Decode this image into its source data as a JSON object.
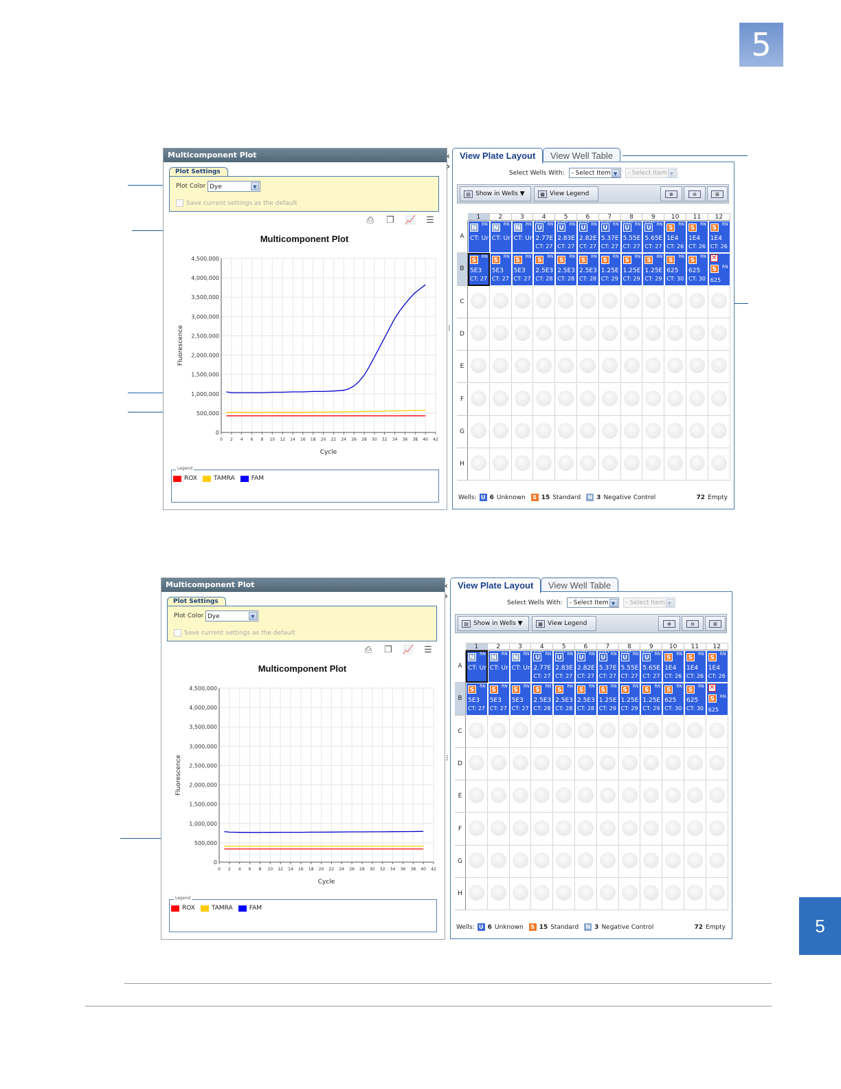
{
  "chapter_number": "5",
  "ui": {
    "panel_title": "Multicomponent Plot",
    "plot_settings_label": "Plot Settings",
    "plot_color_label": "Plot Color",
    "plot_color_value": "Dye",
    "save_default_label": "Save current settings as the default",
    "plot_title": "Multicomponent Plot",
    "y_axis_label": "Fluorescence",
    "x_axis_label": "Cycle",
    "legend_caption": "Legend",
    "legend": [
      {
        "name": "ROX",
        "color": "#ff0000"
      },
      {
        "name": "TAMRA",
        "color": "#ffcc00"
      },
      {
        "name": "FAM",
        "color": "#0000ff"
      }
    ],
    "tab_layout": "View Plate Layout",
    "tab_table": "View Well Table",
    "select_wells_label": "Select Wells With:",
    "select_item": "- Select Item -",
    "show_in_wells": "Show in Wells ▼",
    "view_legend": "View Legend",
    "columns": [
      "1",
      "2",
      "3",
      "4",
      "5",
      "6",
      "7",
      "8",
      "9",
      "10",
      "11",
      "12"
    ],
    "rows": [
      "A",
      "B",
      "C",
      "D",
      "E",
      "F",
      "G",
      "H"
    ],
    "footer": {
      "wells_label": "Wells:",
      "unknown_count": "6",
      "unknown_label": "Unknown",
      "standard_count": "15",
      "standard_label": "Standard",
      "neg_count": "3",
      "neg_label": "Negative Control",
      "empty_count": "72",
      "empty_label": "Empty"
    },
    "well_rn": "RN",
    "row_a": [
      {
        "type": "N",
        "top": "",
        "v1": "CT: Ur",
        "v2": ""
      },
      {
        "type": "N",
        "top": "",
        "v1": "CT: Ur",
        "v2": ""
      },
      {
        "type": "N",
        "top": "",
        "v1": "CT: Ur",
        "v2": ""
      },
      {
        "type": "U",
        "top": "2391",
        "v1": "2.77E",
        "v2": "CT: 27"
      },
      {
        "type": "U",
        "top": "2391",
        "v1": "2.83E",
        "v2": "CT: 27"
      },
      {
        "type": "U",
        "top": "2391",
        "v1": "2.82E",
        "v2": "CT: 27"
      },
      {
        "type": "U",
        "top": "2391",
        "v1": "5.37E",
        "v2": "CT: 27"
      },
      {
        "type": "U",
        "top": "2391",
        "v1": "5.55E",
        "v2": "CT: 27"
      },
      {
        "type": "U",
        "top": "2391",
        "v1": "5.65E",
        "v2": "CT: 27"
      },
      {
        "type": "S",
        "top": "",
        "v1": "1E4",
        "v2": "CT: 26"
      },
      {
        "type": "S",
        "top": "",
        "v1": "1E4",
        "v2": "CT: 26"
      },
      {
        "type": "S",
        "top": "",
        "v1": "1E4",
        "v2": "CT: 26"
      }
    ],
    "row_b": [
      {
        "type": "S",
        "top": "",
        "v1": "5E3",
        "v2": "CT: 27"
      },
      {
        "type": "S",
        "top": "",
        "v1": "5E3",
        "v2": "CT: 27"
      },
      {
        "type": "S",
        "top": "",
        "v1": "5E3",
        "v2": "CT: 27"
      },
      {
        "type": "S",
        "top": "",
        "v1": "2.5E3",
        "v2": "CT: 28"
      },
      {
        "type": "S",
        "top": "",
        "v1": "2.5E3",
        "v2": "CT: 28"
      },
      {
        "type": "S",
        "top": "",
        "v1": "2.5E3",
        "v2": "CT: 28"
      },
      {
        "type": "S",
        "top": "",
        "v1": "1.25E",
        "v2": "CT: 29"
      },
      {
        "type": "S",
        "top": "",
        "v1": "1.25E",
        "v2": "CT: 29"
      },
      {
        "type": "S",
        "top": "",
        "v1": "1.25E",
        "v2": "CT: 29"
      },
      {
        "type": "S",
        "top": "",
        "v1": "625",
        "v2": "CT: 30"
      },
      {
        "type": "S",
        "top": "",
        "v1": "625",
        "v2": "CT: 30"
      },
      {
        "type": "X",
        "top": "",
        "v1": "",
        "v2": "625"
      }
    ]
  },
  "chart_data": [
    {
      "type": "line",
      "title": "Multicomponent Plot",
      "xlabel": "Cycle",
      "ylabel": "Fluorescence",
      "xlim": [
        0,
        42
      ],
      "ylim": [
        0,
        4500000
      ],
      "xticks": [
        "0",
        "2",
        "4",
        "6",
        "8",
        "10",
        "12",
        "14",
        "16",
        "18",
        "20",
        "22",
        "24",
        "26",
        "28",
        "30",
        "32",
        "34",
        "36",
        "38",
        "40",
        "42"
      ],
      "yticks": [
        "0",
        "500,000",
        "1,000,000",
        "1,500,000",
        "2,000,000",
        "2,500,000",
        "3,000,000",
        "3,500,000",
        "4,000,000",
        "4,500,000"
      ],
      "grid": true,
      "x": [
        1,
        2,
        4,
        6,
        8,
        10,
        12,
        14,
        16,
        18,
        20,
        22,
        24,
        25,
        26,
        27,
        28,
        29,
        30,
        31,
        32,
        33,
        34,
        35,
        36,
        37,
        38,
        39,
        40
      ],
      "series": [
        {
          "name": "ROX",
          "color": "#ff0000",
          "values": [
            430000,
            430000,
            430000,
            430000,
            430000,
            430000,
            430000,
            430000,
            430000,
            430000,
            430000,
            430000,
            430000,
            430000,
            430000,
            430000,
            430000,
            430000,
            430000,
            430000,
            430000,
            430000,
            430000,
            430000,
            430000,
            430000,
            430000,
            430000,
            430000
          ]
        },
        {
          "name": "TAMRA",
          "color": "#ffcc00",
          "values": [
            520000,
            520000,
            520000,
            520000,
            520000,
            520000,
            520000,
            520000,
            520000,
            525000,
            525000,
            530000,
            530000,
            535000,
            535000,
            540000,
            540000,
            545000,
            545000,
            550000,
            550000,
            555000,
            555000,
            560000,
            560000,
            565000,
            565000,
            570000,
            575000
          ]
        },
        {
          "name": "FAM",
          "color": "#0000cc",
          "values": [
            1050000,
            1030000,
            1030000,
            1030000,
            1030000,
            1040000,
            1040000,
            1050000,
            1050000,
            1060000,
            1060000,
            1070000,
            1090000,
            1130000,
            1200000,
            1320000,
            1480000,
            1700000,
            1950000,
            2200000,
            2450000,
            2700000,
            2950000,
            3150000,
            3320000,
            3480000,
            3620000,
            3720000,
            3820000
          ]
        }
      ]
    },
    {
      "type": "line",
      "title": "Multicomponent Plot",
      "xlabel": "Cycle",
      "ylabel": "Fluorescence",
      "xlim": [
        0,
        42
      ],
      "ylim": [
        0,
        4500000
      ],
      "xticks": [
        "0",
        "2",
        "4",
        "6",
        "8",
        "10",
        "12",
        "14",
        "16",
        "18",
        "20",
        "22",
        "24",
        "26",
        "28",
        "30",
        "32",
        "34",
        "36",
        "38",
        "40",
        "42"
      ],
      "yticks": [
        "0",
        "500,000",
        "1,000,000",
        "1,500,000",
        "2,000,000",
        "2,500,000",
        "3,000,000",
        "3,500,000",
        "4,000,000",
        "4,500,000"
      ],
      "grid": true,
      "x": [
        1,
        2,
        4,
        6,
        8,
        10,
        12,
        14,
        16,
        18,
        20,
        22,
        24,
        26,
        28,
        30,
        32,
        34,
        36,
        38,
        40
      ],
      "series": [
        {
          "name": "ROX",
          "color": "#ff0000",
          "values": [
            340000,
            340000,
            340000,
            340000,
            340000,
            340000,
            340000,
            340000,
            340000,
            340000,
            340000,
            340000,
            340000,
            340000,
            340000,
            340000,
            340000,
            340000,
            340000,
            340000,
            340000
          ]
        },
        {
          "name": "TAMRA",
          "color": "#ffcc00",
          "values": [
            410000,
            410000,
            410000,
            410000,
            410000,
            410000,
            410000,
            410000,
            410000,
            410000,
            410000,
            410000,
            410000,
            410000,
            410000,
            410000,
            410000,
            410000,
            410000,
            410000,
            410000
          ]
        },
        {
          "name": "FAM",
          "color": "#0000cc",
          "values": [
            790000,
            775000,
            770000,
            768000,
            768000,
            770000,
            772000,
            772000,
            772000,
            775000,
            775000,
            778000,
            780000,
            782000,
            782000,
            785000,
            785000,
            788000,
            790000,
            792000,
            795000
          ]
        }
      ]
    }
  ]
}
